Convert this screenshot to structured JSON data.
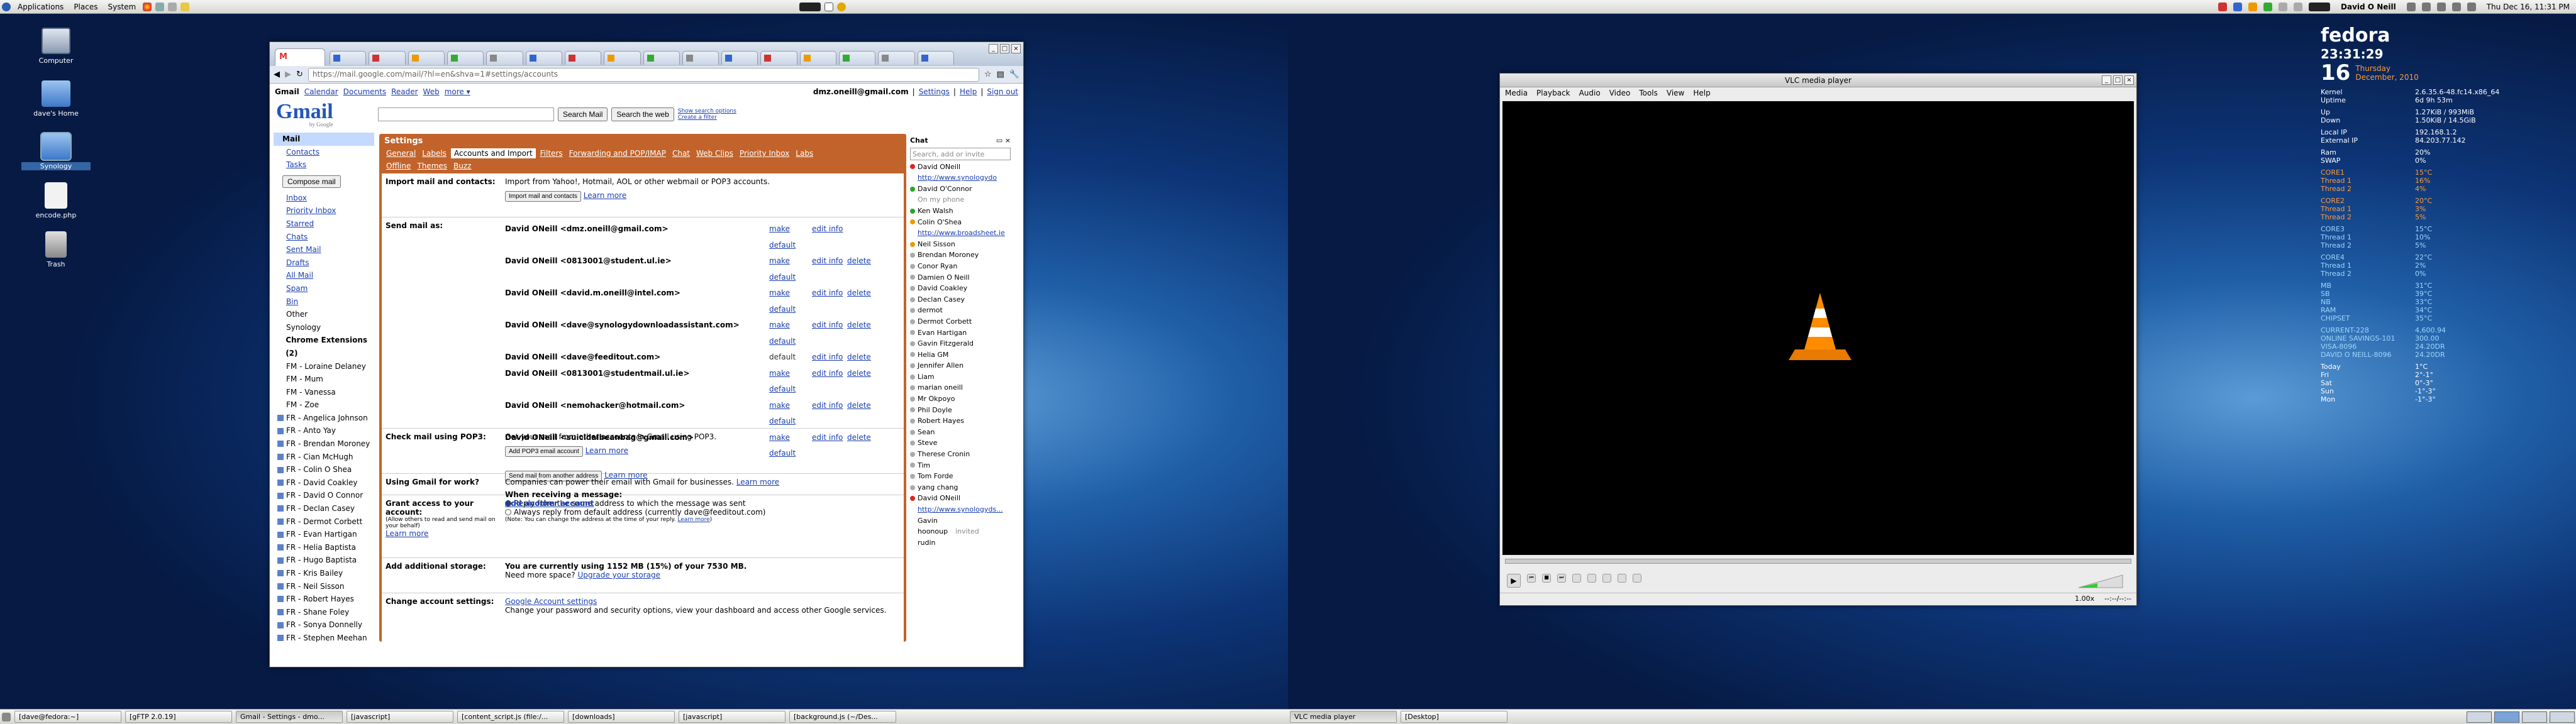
{
  "left_panel": {
    "applications": "Applications",
    "places": "Places",
    "system": "System"
  },
  "right_panel": {
    "user": "David O Neill",
    "datetime": "Thu Dec 16, 11:31 PM"
  },
  "desktop_icons": [
    {
      "label": "Computer"
    },
    {
      "label": "dave's Home"
    },
    {
      "label": "Synology"
    },
    {
      "label": "encode.php"
    },
    {
      "label": "Trash"
    }
  ],
  "taskbar_left": [
    "[dave@fedora:~]",
    "[gFTP 2.0.19]",
    "Gmail - Settings - dmo...",
    "[javascript]",
    "[content_script.js (file:/...",
    "[downloads]",
    "[javascript]",
    "[background.js (~/Des..."
  ],
  "taskbar_right": [
    "VLC media player",
    "[Desktop]"
  ],
  "browser": {
    "url": "https://mail.google.com/mail/?hl=en&shva=1#settings/accounts",
    "topnav": [
      "Gmail",
      "Calendar",
      "Documents",
      "Reader",
      "Web",
      "more ▾"
    ],
    "account": "dmz.oneill@gmail.com",
    "toplinks": [
      "Settings",
      "Help",
      "Sign out"
    ],
    "logo": "Gmail",
    "logo_sub": "by Google",
    "search_mail": "Search Mail",
    "search_web": "Search the web",
    "search_opts": [
      "Show search options",
      "Create a filter"
    ]
  },
  "gmail_sidebar": {
    "top": [
      "Mail",
      "Contacts",
      "Tasks"
    ],
    "compose": "Compose mail",
    "folders": [
      "Inbox",
      "Priority Inbox",
      "Starred",
      "Chats",
      "Sent Mail",
      "Drafts",
      "All Mail",
      "Spam",
      "Bin"
    ],
    "labels": [
      "Other",
      "Synology",
      "Chrome Extensions (2)",
      "FM - Loraine Delaney",
      "FM - Mum",
      "FM - Vanessa",
      "FM - Zoe",
      "FR - Angelica Johnson",
      "FR - Anto Yay",
      "FR - Brendan Moroney",
      "FR - Cian McHugh",
      "FR - Colin O Shea",
      "FR - David Coakley",
      "FR - David O Connor",
      "FR - Declan Casey",
      "FR - Dermot Corbett",
      "FR - Evan Hartigan",
      "FR - Helia Baptista",
      "FR - Hugo Baptista",
      "FR - Kris Bailey",
      "FR - Neil Sisson",
      "FR - Robert Hayes",
      "FR - Shane Foley",
      "FR - Sonya Donnelly",
      "FR - Stephen Meehan"
    ]
  },
  "settings": {
    "title": "Settings",
    "tabs_row1": [
      "General",
      "Labels",
      "Accounts and Import",
      "Filters",
      "Forwarding and POP/IMAP",
      "Chat",
      "Web Clips",
      "Priority Inbox",
      "Labs"
    ],
    "tabs_row2": [
      "Offline",
      "Themes",
      "Buzz"
    ],
    "import_label": "Import mail and contacts:",
    "import_text": "Import from Yahoo!, Hotmail, AOL or other webmail or POP3 accounts.",
    "import_btn": "Import mail and contacts",
    "learn_more": "Learn more",
    "sendas_label": "Send mail as:",
    "sendas": [
      {
        "addr": "David ONeill <dmz.oneill@gmail.com>",
        "a1": "make default",
        "a2": "edit info",
        "a3": ""
      },
      {
        "addr": "David ONeill <0813001@student.ul.ie>",
        "a1": "make default",
        "a2": "edit info",
        "a3": "delete"
      },
      {
        "addr": "David ONeill <david.m.oneill@intel.com>",
        "a1": "make default",
        "a2": "edit info",
        "a3": "delete"
      },
      {
        "addr": "David ONeill <dave@synologydownloadassistant.com>",
        "a1": "make default",
        "a2": "edit info",
        "a3": "delete"
      },
      {
        "addr": "David ONeill <dave@feeditout.com>",
        "a1": "default",
        "a2": "edit info",
        "a3": "delete"
      },
      {
        "addr": "David ONeill <0813001@studentmail.ul.ie>",
        "a1": "make default",
        "a2": "edit info",
        "a3": "delete"
      },
      {
        "addr": "David ONeill <nemohacker@hotmail.com>",
        "a1": "make default",
        "a2": "edit info",
        "a3": "delete"
      },
      {
        "addr": "David ONeill <suicidalbeanbag@gmail.com>",
        "a1": "make default",
        "a2": "edit info",
        "a3": "delete"
      }
    ],
    "send_other_btn": "Send mail from another address",
    "when_receiving": "When receiving a message:",
    "reply_opt1": "Reply from the same address to which the message was sent",
    "reply_opt2": "Always reply from default address (currently dave@feeditout.com)",
    "reply_note": "(Note: You can change the address at the time of your reply.",
    "pop_label": "Check mail using POP3:",
    "pop_text": "Get your mail from other accounts in Gmail using POP3.",
    "pop_btn": "Add POP3 email account",
    "work_label": "Using Gmail for work?",
    "work_text": "Companies can power their email with Gmail for businesses.",
    "grant_label": "Grant access to your account:",
    "grant_sub": "(Allow others to read and send mail on your behalf)",
    "grant_link": "Add another account",
    "storage_label": "Add additional storage:",
    "storage_text": "You are currently using 1152 MB (15%) of your 7530 MB.",
    "storage_more": "Need more space?",
    "storage_link": "Upgrade your storage",
    "change_label": "Change account settings:",
    "change_link": "Google Account settings",
    "change_text": "Change your password and security options, view your dashboard and access other Google services."
  },
  "chat": {
    "title": "Chat",
    "search_ph": "Search, add or invite",
    "me": "David ONeill",
    "me_status": "http://www.synologydo",
    "contacts": [
      {
        "name": "David O'Connor",
        "status": "green"
      },
      {
        "name": "On my phone",
        "status": "sub"
      },
      {
        "name": "Ken Walsh",
        "status": "green"
      },
      {
        "name": "Colin O'Shea",
        "status": "orange"
      },
      {
        "name": "http://www.broadsheet.ie",
        "status": "sub"
      },
      {
        "name": "Neil Sisson",
        "status": "orange"
      },
      {
        "name": "Brendan Moroney",
        "status": "grey"
      },
      {
        "name": "Conor Ryan",
        "status": "grey"
      },
      {
        "name": "Damien O Neill",
        "status": "grey"
      },
      {
        "name": "David Coakley",
        "status": "grey"
      },
      {
        "name": "Declan Casey",
        "status": "grey"
      },
      {
        "name": "dermot",
        "status": "grey"
      },
      {
        "name": "Dermot Corbett",
        "status": "grey"
      },
      {
        "name": "Evan Hartigan",
        "status": "grey"
      },
      {
        "name": "Gavin Fitzgerald",
        "status": "grey"
      },
      {
        "name": "Helia GM",
        "status": "grey"
      },
      {
        "name": "Jennifer Allen",
        "status": "grey"
      },
      {
        "name": "Liam",
        "status": "grey"
      },
      {
        "name": "marian oneill",
        "status": "grey"
      },
      {
        "name": "Mr Okpoyo",
        "status": "grey"
      },
      {
        "name": "Phil Doyle",
        "status": "grey"
      },
      {
        "name": "Robert Hayes",
        "status": "grey"
      },
      {
        "name": "Sean",
        "status": "grey"
      },
      {
        "name": "Steve",
        "status": "grey"
      },
      {
        "name": "Therese Cronin",
        "status": "grey"
      },
      {
        "name": "Tim",
        "status": "grey"
      },
      {
        "name": "Tom Forde",
        "status": "grey"
      },
      {
        "name": "yang chang",
        "status": "grey"
      },
      {
        "name": "David ONeill",
        "status": "red"
      },
      {
        "name": "http://www.synologyds...",
        "status": "sub"
      },
      {
        "name": "Gavin",
        "status": "none"
      },
      {
        "name": "hoonoup",
        "status": "none"
      },
      {
        "name": "rudin",
        "status": "none"
      }
    ],
    "invited": "invited"
  },
  "vlc": {
    "title": "VLC media player",
    "menu": [
      "Media",
      "Playback",
      "Audio",
      "Video",
      "Tools",
      "View",
      "Help"
    ],
    "speed": "1.00x",
    "time": "--:--/--:--"
  },
  "conky": {
    "distro": "fedora",
    "time": "23:31:29",
    "day": "16",
    "weekday": "Thursday",
    "month": "December, 2010",
    "sys": [
      [
        "Kernel",
        "2.6.35.6-48.fc14.x86_64"
      ],
      [
        "Uptime",
        "6d 9h 53m"
      ]
    ],
    "net": [
      [
        "Up",
        "1.27KiB / 993MiB"
      ],
      [
        "Down",
        "1.50KiB / 14.5GiB"
      ]
    ],
    "ip": [
      [
        "Local IP",
        "192.168.1.2"
      ],
      [
        "External IP",
        "84.203.77.142"
      ]
    ],
    "mem": [
      [
        "Ram",
        "20%"
      ],
      [
        "SWAP",
        "0%"
      ]
    ],
    "core1": [
      [
        "CORE1",
        "15°C"
      ],
      [
        "Thread 1",
        "16%"
      ],
      [
        "Thread 2",
        "4%"
      ]
    ],
    "core2": [
      [
        "CORE2",
        "20°C"
      ],
      [
        "Thread 1",
        "3%"
      ],
      [
        "Thread 2",
        "5%"
      ]
    ],
    "core3": [
      [
        "CORE3",
        "15°C"
      ],
      [
        "Thread 1",
        "10%"
      ],
      [
        "Thread 2",
        "5%"
      ]
    ],
    "core4": [
      [
        "CORE4",
        "22°C"
      ],
      [
        "Thread 1",
        "2%"
      ],
      [
        "Thread 2",
        "0%"
      ]
    ],
    "sens": [
      [
        "MB",
        "31°C"
      ],
      [
        "SB",
        "39°C"
      ],
      [
        "NB",
        "33°C"
      ],
      [
        "RAM",
        "34°C"
      ],
      [
        "CHIPSET",
        "35°C"
      ]
    ],
    "accounts": [
      [
        "CURRENT-228",
        "4,600.94"
      ],
      [
        "ONLINE SAVINGS-101",
        "300.00"
      ],
      [
        "VISA-8096",
        "24.20DR"
      ],
      [
        "DAVID O NEILL-8096",
        "24.20DR"
      ]
    ],
    "weather": [
      [
        "Today",
        "1°C"
      ],
      [
        "Fri",
        "2°-1°"
      ],
      [
        "Sat",
        "0°-3°"
      ],
      [
        "Sun",
        "-1°-3°"
      ],
      [
        "Mon",
        "-1°-3°"
      ]
    ]
  }
}
